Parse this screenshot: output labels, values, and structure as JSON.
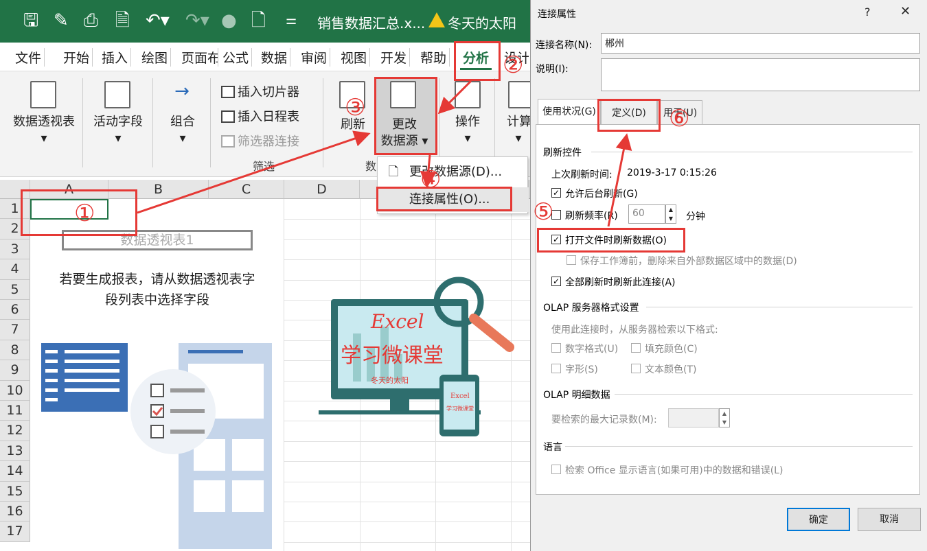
{
  "excel": {
    "filename": "销售数据汇总.x...",
    "user": "冬天的太阳",
    "qat_icons": [
      "save-icon",
      "brush-icon",
      "preview-icon",
      "print-preview-icon",
      "undo-icon",
      "redo-icon",
      "circle-icon",
      "file-icon",
      "customize-icon"
    ],
    "tabs": [
      "文件",
      "开始",
      "插入",
      "绘图",
      "页面布",
      "公式",
      "数据",
      "审阅",
      "视图",
      "开发",
      "帮助",
      "分析",
      "设计"
    ],
    "ribbon": {
      "pivot_table": "数据透视表",
      "active_field": "活动字段",
      "group": "组合",
      "insert_slicer": "插入切片器",
      "insert_timeline": "插入日程表",
      "filter_conn": "筛选器连接",
      "filter_group": "筛选",
      "refresh": "刷新",
      "change_source_1": "更改",
      "change_source_2": "数据源",
      "actions": "操作",
      "calc": "计算",
      "data_group": "数"
    },
    "menu": {
      "change_source": "更改数据源(D)...",
      "conn_props": "连接属性(O)..."
    },
    "sheet": {
      "columns": [
        "A",
        "B",
        "C",
        "D"
      ],
      "rows": [
        "1",
        "2",
        "3",
        "4",
        "5",
        "6",
        "7",
        "8",
        "9",
        "10",
        "11",
        "12",
        "13",
        "14",
        "15",
        "16",
        "17"
      ],
      "pivot_name": "数据透视表1",
      "pivot_msg_1": "若要生成报表，请从数据透视表字",
      "pivot_msg_2": "段列表中选择字段"
    },
    "logo": {
      "title": "Excel",
      "sub": "学习微课堂",
      "author": "冬天的太阳",
      "phone_title": "Excel",
      "phone_sub": "学习微课堂"
    }
  },
  "annotations": [
    "①",
    "②",
    "③",
    "④",
    "⑤",
    "⑥"
  ],
  "dialog": {
    "title": "连接属性",
    "help": "?",
    "close": "✕",
    "name_label": "连接名称(N):",
    "name_value": "郴州",
    "desc_label": "说明(I):",
    "tabs": [
      "使用状况(G)",
      "定义(D)",
      "用于(U)"
    ],
    "refresh_section": "刷新控件",
    "last_refresh_label": "上次刷新时间:",
    "last_refresh_value": "2019-3-17  0:15:26",
    "bg_refresh": "允许后台刷新(G)",
    "refresh_every": "刷新频率(R)",
    "refresh_minutes": "60",
    "minutes_unit": "分钟",
    "refresh_on_open": "打开文件时刷新数据(O)",
    "remove_ext": "保存工作簿前，删除来自外部数据区域中的数据(D)",
    "refresh_all": "全部刷新时刷新此连接(A)",
    "olap_format_section": "OLAP 服务器格式设置",
    "olap_format_desc": "使用此连接时，从服务器检索以下格式:",
    "num_format": "数字格式(U)",
    "fill_color": "填充颜色(C)",
    "font_style": "字形(S)",
    "text_color": "文本颜色(T)",
    "olap_detail_section": "OLAP 明细数据",
    "max_records": "要检索的最大记录数(M):",
    "lang_section": "语言",
    "lang_option": "检索 Office 显示语言(如果可用)中的数据和错误(L)",
    "ok": "确定",
    "cancel": "取消"
  },
  "colors": {
    "excel_green": "#217346",
    "annotation_red": "#e53935",
    "logo_teal": "#2e6e6e"
  }
}
